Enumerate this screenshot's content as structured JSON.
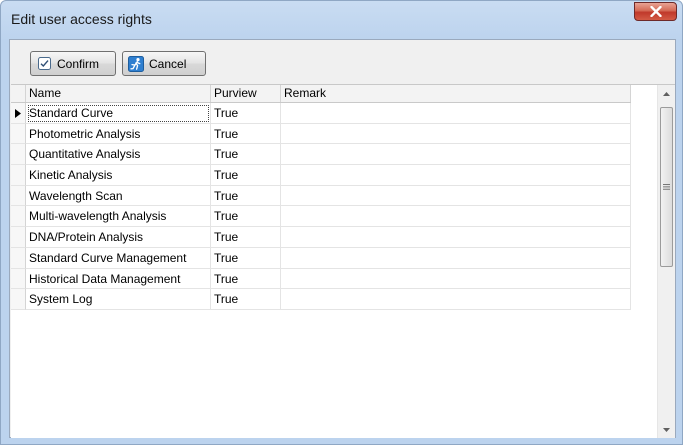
{
  "window": {
    "title": "Edit user access rights"
  },
  "toolbar": {
    "confirm_label": "Confirm",
    "cancel_label": "Cancel"
  },
  "grid": {
    "columns": [
      "Name",
      "Purview",
      "Remark"
    ],
    "rows": [
      {
        "name": "Standard Curve",
        "purview": "True",
        "remark": ""
      },
      {
        "name": "Photometric Analysis",
        "purview": "True",
        "remark": ""
      },
      {
        "name": "Quantitative Analysis",
        "purview": "True",
        "remark": ""
      },
      {
        "name": "Kinetic Analysis",
        "purview": "True",
        "remark": ""
      },
      {
        "name": "Wavelength Scan",
        "purview": "True",
        "remark": ""
      },
      {
        "name": "Multi-wavelength Analysis",
        "purview": "True",
        "remark": ""
      },
      {
        "name": "DNA/Protein Analysis",
        "purview": "True",
        "remark": ""
      },
      {
        "name": "Standard Curve Management",
        "purview": "True",
        "remark": ""
      },
      {
        "name": "Historical Data Management",
        "purview": "True",
        "remark": ""
      },
      {
        "name": "System Log",
        "purview": "True",
        "remark": ""
      }
    ]
  },
  "icons": {
    "close": "close-icon",
    "confirm": "checkbox-check-icon",
    "cancel": "running-person-icon",
    "current_row": "row-pointer-icon"
  }
}
